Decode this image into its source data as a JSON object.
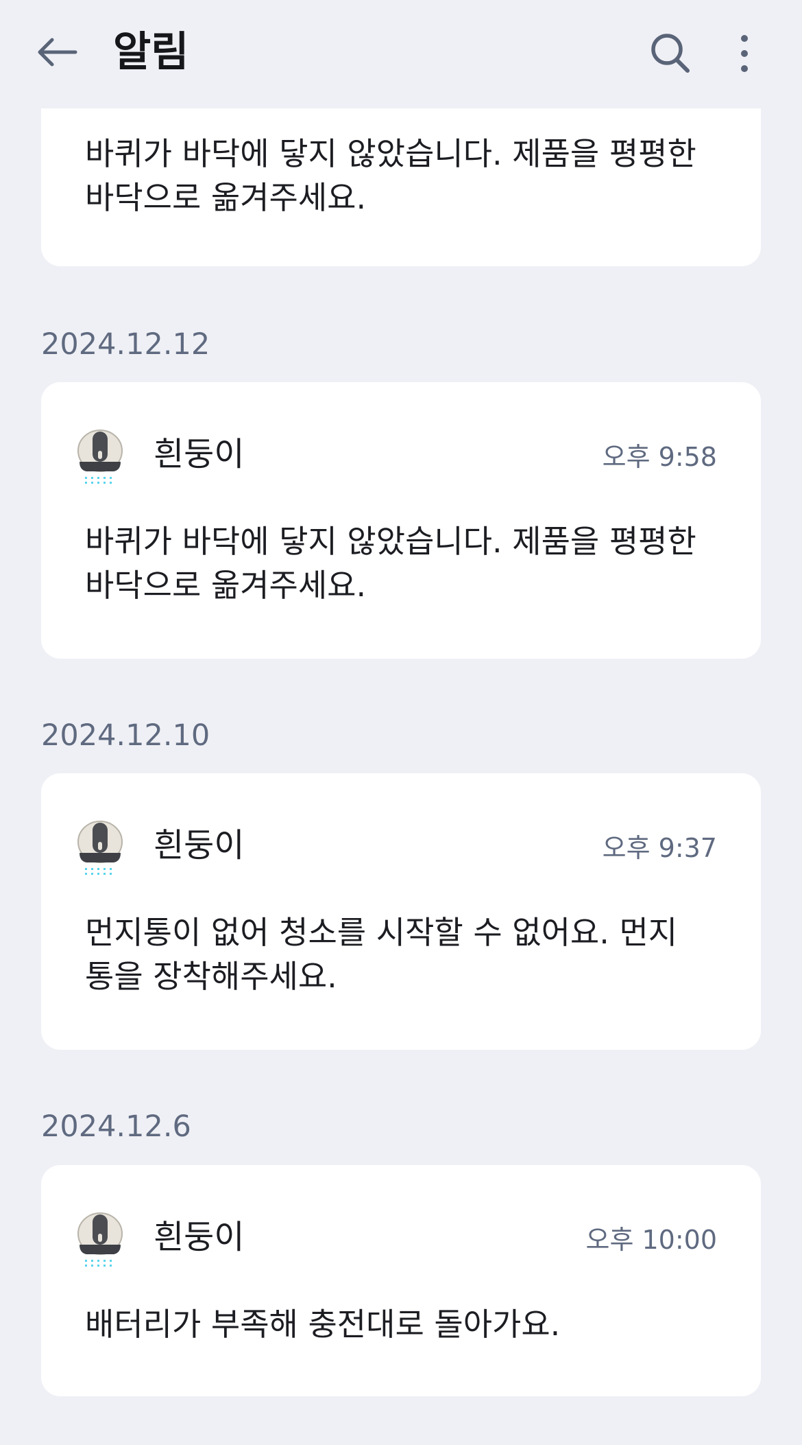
{
  "header": {
    "title": "알림",
    "back_icon": "arrow-left-icon",
    "search_icon": "search-icon",
    "more_icon": "more-vertical-icon"
  },
  "partial_card": {
    "message_lines": [
      "바퀴가 바닥에 닿지 않았습니다. 제품을 평평한",
      "바닥으로 옮겨주세요."
    ]
  },
  "groups": [
    {
      "date": "2024.12.12",
      "device": "흰둥이",
      "time": "오후 9:58",
      "message_lines": [
        "바퀴가 바닥에 닿지 않았습니다. 제품을 평평한",
        "바닥으로 옮겨주세요."
      ]
    },
    {
      "date": "2024.12.10",
      "device": "흰둥이",
      "time": "오후 9:37",
      "message_lines": [
        "먼지통이 없어 청소를 시작할 수 없어요. 먼지",
        "통을 장착해주세요."
      ]
    },
    {
      "date": "2024.12.6",
      "device": "흰둥이",
      "time": "오후 10:00",
      "message_lines": [
        "배터리가 부족해 충전대로 돌아가요."
      ]
    }
  ],
  "colors": {
    "background": "#eff0f5",
    "card": "#ffffff",
    "secondary_text": "#5f6a80",
    "icon": "#5a6478"
  }
}
